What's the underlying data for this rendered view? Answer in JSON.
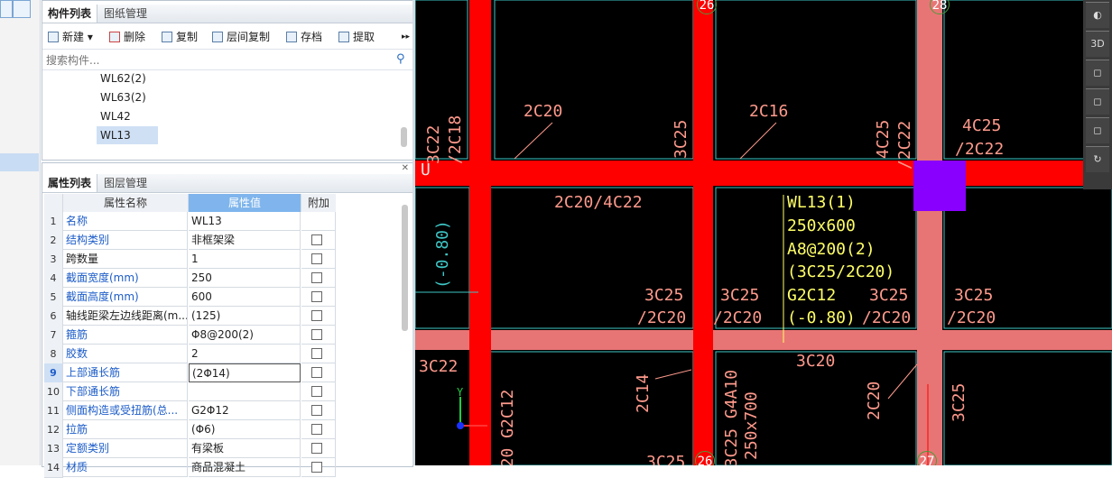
{
  "component_panel": {
    "tabs": [
      "构件列表",
      "图纸管理"
    ],
    "toolbar": [
      "新建",
      "删除",
      "复制",
      "层间复制",
      "存档",
      "提取"
    ],
    "toolbar_more": "▸▸",
    "search_placeholder": "搜索构件...",
    "items": [
      "WL62(2)",
      "WL63(2)",
      "WL42",
      "WL13"
    ],
    "selected_item": "WL13"
  },
  "property_panel": {
    "tabs": [
      "属性列表",
      "图层管理"
    ],
    "headers": {
      "name": "属性名称",
      "value": "属性值",
      "extra": "附加"
    },
    "rows": [
      {
        "num": "1",
        "name": "名称",
        "value": "WL13",
        "blue": true,
        "checkbox": false
      },
      {
        "num": "2",
        "name": "结构类别",
        "value": "非框架梁",
        "blue": true,
        "checkbox": true
      },
      {
        "num": "3",
        "name": "跨数量",
        "value": "1",
        "blue": false,
        "checkbox": true
      },
      {
        "num": "4",
        "name": "截面宽度(mm)",
        "value": "250",
        "blue": true,
        "checkbox": true
      },
      {
        "num": "5",
        "name": "截面高度(mm)",
        "value": "600",
        "blue": true,
        "checkbox": true
      },
      {
        "num": "6",
        "name": "轴线距梁左边线距离(m...",
        "value": "(125)",
        "blue": false,
        "checkbox": true
      },
      {
        "num": "7",
        "name": "箍筋",
        "value": "Φ8@200(2)",
        "blue": true,
        "checkbox": true
      },
      {
        "num": "8",
        "name": "胶数",
        "value": "2",
        "blue": true,
        "checkbox": true
      },
      {
        "num": "9",
        "name": "上部通长筋",
        "value": "(2Φ14)",
        "blue": true,
        "checkbox": true
      },
      {
        "num": "10",
        "name": "下部通长筋",
        "value": "",
        "blue": true,
        "checkbox": true
      },
      {
        "num": "11",
        "name": "侧面构造或受扭筋(总...",
        "value": "G2Φ12",
        "blue": true,
        "checkbox": true
      },
      {
        "num": "12",
        "name": "拉筋",
        "value": "(Φ6)",
        "blue": true,
        "checkbox": true
      },
      {
        "num": "13",
        "name": "定额类别",
        "value": "有梁板",
        "blue": true,
        "checkbox": true
      },
      {
        "num": "14",
        "name": "材质",
        "value": "商品混凝土",
        "blue": true,
        "checkbox": true
      }
    ],
    "selected_row": "9"
  },
  "cad": {
    "axis_labels": [
      "26",
      "28",
      "26",
      "27"
    ],
    "beam_info": [
      "WL13(1)",
      "250x600",
      "A8@200(2)",
      "(3C25/2C20)",
      "G2C12",
      "(-0.80)"
    ],
    "labels_h": [
      {
        "text": "2C20"
      },
      {
        "text": "2C16"
      },
      {
        "text": "4C25"
      },
      {
        "text": "/2C22"
      },
      {
        "text": "2C20/4C22"
      },
      {
        "text": "3C25"
      },
      {
        "text": "/2C20"
      },
      {
        "text": "3C25"
      },
      {
        "text": "/2C20"
      },
      {
        "text": "3C25"
      },
      {
        "text": "/2C20"
      },
      {
        "text": "3C25"
      },
      {
        "text": "/2C20"
      },
      {
        "text": "3C22"
      },
      {
        "text": "3C20"
      },
      {
        "text": "3C25"
      }
    ],
    "labels_v": [
      "3C22",
      "/2C18",
      "3C25",
      "4C25",
      "/2C22",
      "2C14",
      "2C20",
      "3C25",
      "(-0.80)",
      "3C20 G2C12",
      "P/3C25 G4A10",
      "250x700"
    ],
    "u_marks": [
      "U",
      "U"
    ],
    "axis_y": "Y",
    "view_buttons": [
      "3D"
    ],
    "colors": {
      "beam_red": "#ff0000",
      "beam_pink": "#e87575",
      "selection": "#8a00ff",
      "text_label": "#ff9a8c",
      "text_info": "#ffff66"
    }
  }
}
